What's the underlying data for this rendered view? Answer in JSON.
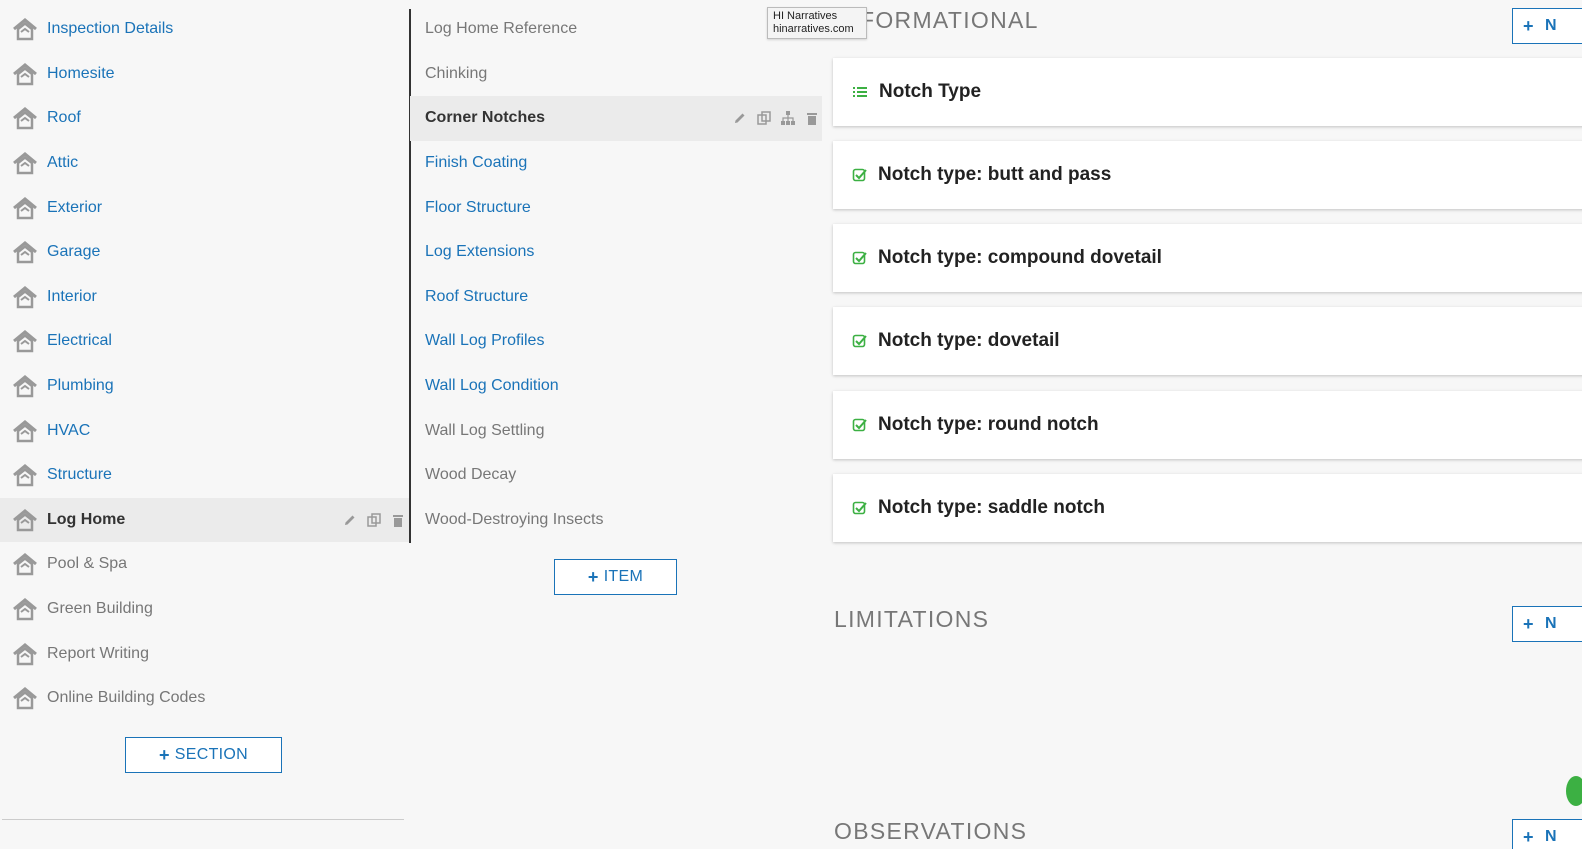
{
  "sections": {
    "items": [
      {
        "label": "Inspection Details",
        "state": "link"
      },
      {
        "label": "Homesite",
        "state": "link"
      },
      {
        "label": "Roof",
        "state": "link"
      },
      {
        "label": "Attic",
        "state": "link"
      },
      {
        "label": "Exterior",
        "state": "link"
      },
      {
        "label": "Garage",
        "state": "link"
      },
      {
        "label": "Interior",
        "state": "link"
      },
      {
        "label": "Electrical",
        "state": "link"
      },
      {
        "label": "Plumbing",
        "state": "link"
      },
      {
        "label": "HVAC",
        "state": "link"
      },
      {
        "label": "Structure",
        "state": "link"
      },
      {
        "label": "Log Home",
        "state": "active"
      },
      {
        "label": "Pool & Spa",
        "state": "muted"
      },
      {
        "label": "Green Building",
        "state": "muted"
      },
      {
        "label": "Report Writing",
        "state": "muted"
      },
      {
        "label": "Online Building Codes",
        "state": "muted"
      }
    ],
    "add_label": "SECTION"
  },
  "items": {
    "list": [
      {
        "label": "Log Home Reference",
        "state": "muted"
      },
      {
        "label": "Chinking",
        "state": "muted"
      },
      {
        "label": "Corner Notches",
        "state": "active"
      },
      {
        "label": "Finish Coating",
        "state": "link"
      },
      {
        "label": "Floor Structure",
        "state": "link"
      },
      {
        "label": "Log Extensions",
        "state": "link"
      },
      {
        "label": "Roof Structure",
        "state": "link"
      },
      {
        "label": "Wall Log Profiles",
        "state": "link"
      },
      {
        "label": "Wall Log Condition",
        "state": "link"
      },
      {
        "label": "Wall Log Settling",
        "state": "muted"
      },
      {
        "label": "Wood Decay",
        "state": "muted"
      },
      {
        "label": "Wood-Destroying Insects",
        "state": "muted"
      }
    ],
    "add_label": "ITEM"
  },
  "tooltip": {
    "line1": "HI Narratives",
    "line2": "hinarratives.com"
  },
  "content": {
    "informational": {
      "heading": "FORMATIONAL",
      "add_label": "N",
      "cards": [
        {
          "title": "Notch Type",
          "icon": "list-icon"
        },
        {
          "title": "Notch type: butt and pass",
          "icon": "checkbox-checked-icon"
        },
        {
          "title": "Notch type: compound dovetail",
          "icon": "checkbox-checked-icon"
        },
        {
          "title": "Notch type: dovetail",
          "icon": "checkbox-checked-icon"
        },
        {
          "title": "Notch type: round notch",
          "icon": "checkbox-checked-icon"
        },
        {
          "title": "Notch type: saddle notch",
          "icon": "checkbox-checked-icon"
        }
      ]
    },
    "limitations": {
      "heading": "LIMITATIONS",
      "add_label": "N"
    },
    "observations": {
      "heading": "OBSERVATIONS",
      "add_label": "N"
    }
  },
  "colors": {
    "link": "#1a73b8",
    "muted": "#777777",
    "active_bg": "#ebebeb",
    "check_green": "#3cb043"
  }
}
